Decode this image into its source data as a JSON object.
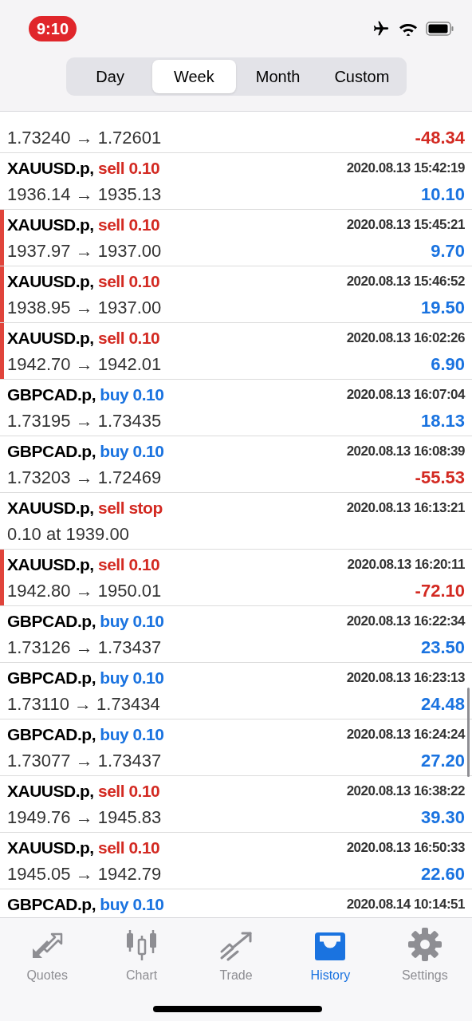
{
  "status_bar": {
    "time": "9:10",
    "recording": true
  },
  "period_tabs": [
    {
      "label": "Day",
      "selected": false
    },
    {
      "label": "Week",
      "selected": true
    },
    {
      "label": "Month",
      "selected": false
    },
    {
      "label": "Custom",
      "selected": false
    }
  ],
  "deals": [
    {
      "detail": "1.73240 → 1.72601",
      "profit": "-48.34",
      "loss": true,
      "marked": false
    },
    {
      "symbol": "XAUUSD.p,",
      "color": "#d32a22",
      "order": "sell 0.10",
      "time": "2020.08.13 15:42:19",
      "detail": "1936.14 → 1935.13",
      "profit": "10.10",
      "loss": false,
      "marked": false
    },
    {
      "symbol": "XAUUSD.p,",
      "color": "#d32a22",
      "order": "sell 0.10",
      "time": "2020.08.13 15:45:21",
      "detail": "1937.97 → 1937.00",
      "profit": "9.70",
      "loss": false,
      "marked": true
    },
    {
      "symbol": "XAUUSD.p,",
      "color": "#d32a22",
      "order": "sell 0.10",
      "time": "2020.08.13 15:46:52",
      "detail": "1938.95 → 1937.00",
      "profit": "19.50",
      "loss": false,
      "marked": true
    },
    {
      "symbol": "XAUUSD.p,",
      "color": "#d32a22",
      "order": "sell 0.10",
      "time": "2020.08.13 16:02:26",
      "detail": "1942.70 → 1942.01",
      "profit": "6.90",
      "loss": false,
      "marked": true
    },
    {
      "symbol": "GBPCAD.p,",
      "color": "#1a73e0",
      "order": "buy 0.10",
      "time": "2020.08.13 16:07:04",
      "detail": "1.73195 → 1.73435",
      "profit": "18.13",
      "loss": false,
      "marked": false
    },
    {
      "symbol": "GBPCAD.p,",
      "color": "#1a73e0",
      "order": "buy 0.10",
      "time": "2020.08.13 16:08:39",
      "detail": "1.73203 → 1.72469",
      "profit": "-55.53",
      "loss": true,
      "marked": false
    },
    {
      "symbol": "XAUUSD.p,",
      "color": "#d32a22",
      "order": "sell stop",
      "time": "2020.08.13 16:13:21",
      "detail": "0.10 at 1939.00",
      "marked": false
    },
    {
      "symbol": "XAUUSD.p,",
      "color": "#d32a22",
      "order": "sell 0.10",
      "time": "2020.08.13 16:20:11",
      "detail": "1942.80 → 1950.01",
      "profit": "-72.10",
      "loss": true,
      "marked": true
    },
    {
      "symbol": "GBPCAD.p,",
      "color": "#1a73e0",
      "order": "buy 0.10",
      "time": "2020.08.13 16:22:34",
      "detail": "1.73126 → 1.73437",
      "profit": "23.50",
      "loss": false,
      "marked": false
    },
    {
      "symbol": "GBPCAD.p,",
      "color": "#1a73e0",
      "order": "buy 0.10",
      "time": "2020.08.13 16:23:13",
      "detail": "1.73110 → 1.73434",
      "profit": "24.48",
      "loss": false,
      "marked": false
    },
    {
      "symbol": "GBPCAD.p,",
      "color": "#1a73e0",
      "order": "buy 0.10",
      "time": "2020.08.13 16:24:24",
      "detail": "1.73077 → 1.73437",
      "profit": "27.20",
      "loss": false,
      "marked": false
    },
    {
      "symbol": "XAUUSD.p,",
      "color": "#d32a22",
      "order": "sell 0.10",
      "time": "2020.08.13 16:38:22",
      "detail": "1949.76 → 1945.83",
      "profit": "39.30",
      "loss": false,
      "marked": false
    },
    {
      "symbol": "XAUUSD.p,",
      "color": "#d32a22",
      "order": "sell 0.10",
      "time": "2020.08.13 16:50:33",
      "detail": "1945.05 → 1942.79",
      "profit": "22.60",
      "loss": false,
      "marked": false
    },
    {
      "symbol": "GBPCAD.p,",
      "color": "#1a73e0",
      "order": "buy 0.10",
      "time": "2020.08.14 10:14:51",
      "marked": false
    }
  ],
  "tab_bar": [
    {
      "kind": "quotes",
      "label": "Quotes",
      "selected": false
    },
    {
      "kind": "chart",
      "label": "Chart",
      "selected": false
    },
    {
      "kind": "trade",
      "label": "Trade",
      "selected": false
    },
    {
      "kind": "history",
      "label": "History",
      "selected": true
    },
    {
      "kind": "settings",
      "label": "Settings",
      "selected": false
    }
  ]
}
